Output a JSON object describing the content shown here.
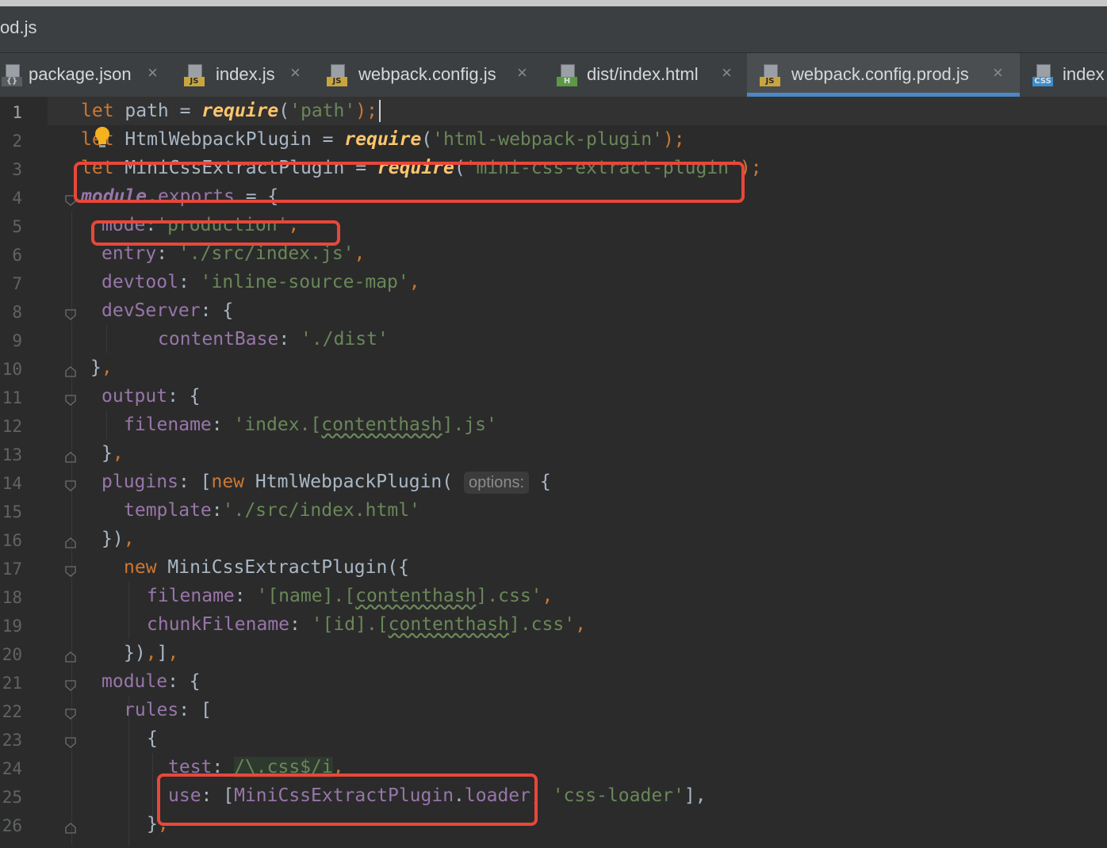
{
  "window": {
    "title_fragment": "od.js"
  },
  "tabs": [
    {
      "label": "package.json",
      "type": "JSON"
    },
    {
      "label": "index.js",
      "type": "JS"
    },
    {
      "label": "webpack.config.js",
      "type": "JS"
    },
    {
      "label": "dist/index.html",
      "type": "H"
    },
    {
      "label": "webpack.config.prod.js",
      "type": "JS",
      "active": true
    },
    {
      "label": "index",
      "type": "CSS"
    }
  ],
  "close_glyph": "×",
  "line_numbers": [
    "1",
    "2",
    "3",
    "4",
    "5",
    "6",
    "7",
    "8",
    "9",
    "10",
    "11",
    "12",
    "13",
    "14",
    "15",
    "16",
    "17",
    "18",
    "19",
    "20",
    "21",
    "22",
    "23",
    "24",
    "25",
    "26"
  ],
  "code": {
    "l1": {
      "t1": "let",
      "t2": " path ",
      "t3": "= ",
      "t4": "require",
      "t5": "(",
      "t6": "'path'",
      "t7": ");"
    },
    "l2": {
      "t1": "let",
      "t2": " HtmlWebpackPlugin ",
      "t3": "= ",
      "t4": "require",
      "t5": "(",
      "t6": "'html-webpack-plugin'",
      "t7": ");"
    },
    "l3": {
      "t1": "let",
      "t2": " MiniCssExtractPlugin ",
      "t3": "= ",
      "t4": "require",
      "t5": "(",
      "t6": "'mini-css-extract-plugin'",
      "t7": ");"
    },
    "l4": {
      "t1": "module",
      "t2": ".",
      "t3": "exports",
      "t4": " = {"
    },
    "l5": {
      "t1": "mode",
      "t2": ":",
      "t3": "'production'",
      "t4": ","
    },
    "l6": {
      "t1": "entry",
      "t2": ": ",
      "t3": "'./src/index.js'",
      "t4": ","
    },
    "l7": {
      "t1": "devtool",
      "t2": ": ",
      "t3": "'inline-source-map'",
      "t4": ","
    },
    "l8": {
      "t1": "devServer",
      "t2": ": {"
    },
    "l9": {
      "t1": "contentBase",
      "t2": ": ",
      "t3": "'./dist'"
    },
    "l10": {
      "t1": "}",
      "t2": ","
    },
    "l11": {
      "t1": "output",
      "t2": ": {"
    },
    "l12": {
      "t1": "filename",
      "t2": ": ",
      "t3": "'index.[",
      "t4": "contenthash",
      "t5": "].js'"
    },
    "l13": {
      "t1": "}",
      "t2": ","
    },
    "l14": {
      "t1": "plugins",
      "t2": ": [",
      "t3": "new",
      "t4": " HtmlWebpackPlugin(",
      "t5": "options:",
      "t6": " {"
    },
    "l15": {
      "t1": "template",
      "t2": ":",
      "t3": "'./src/index.html'"
    },
    "l16": {
      "t1": "})",
      "t2": ","
    },
    "l17": {
      "t1": "new",
      "t2": " MiniCssExtractPlugin({"
    },
    "l18": {
      "t1": "filename",
      "t2": ": ",
      "t3": "'[name].[",
      "t4": "contenthash",
      "t5": "].css'",
      "t6": ","
    },
    "l19": {
      "t1": "chunkFilename",
      "t2": ": ",
      "t3": "'[id].[",
      "t4": "contenthash",
      "t5": "].css'",
      "t6": ","
    },
    "l20": {
      "t1": "})",
      "t2": ",",
      "t3": "]",
      "t4": ","
    },
    "l21": {
      "t1": "module",
      "t2": ": {"
    },
    "l22": {
      "t1": "rules",
      "t2": ": ["
    },
    "l23": {
      "t1": "{"
    },
    "l24": {
      "t1": "test",
      "t2": ": ",
      "t3": "/\\.css$/i",
      "t4": ","
    },
    "l25": {
      "t1": "use",
      "t2": ": [",
      "t3": "MiniCssExtractPlugin",
      "t4": ".",
      "t5": "loader",
      "t6": ", ",
      "t7": "'css-loader'",
      "t8": "],"
    },
    "l26": {
      "t1": "}",
      "t2": ","
    }
  },
  "colors": {
    "keyword": "#cc7832",
    "string": "#6a8759",
    "function": "#ffc66d",
    "property": "#9876aa",
    "text": "#a9b7c6",
    "annotation": "#e8473a",
    "active_tab_underline": "#4a88c7"
  }
}
